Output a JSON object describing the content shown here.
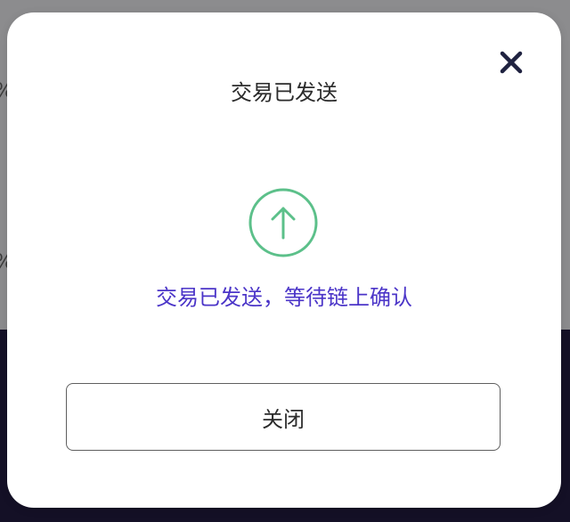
{
  "background": {
    "fragments": [
      "%",
      "%"
    ],
    "small_fragments": [
      "ʷ",
      "ʷ"
    ]
  },
  "modal": {
    "title": "交易已发送",
    "status_text": "交易已发送，等待链上确认",
    "close_button_label": "关闭",
    "icons": {
      "close": "close-icon",
      "status": "arrow-up-circle-icon"
    },
    "colors": {
      "status_text": "#4b35c8",
      "icon_green": "#5cc08a",
      "close_icon": "#1f2240"
    }
  }
}
